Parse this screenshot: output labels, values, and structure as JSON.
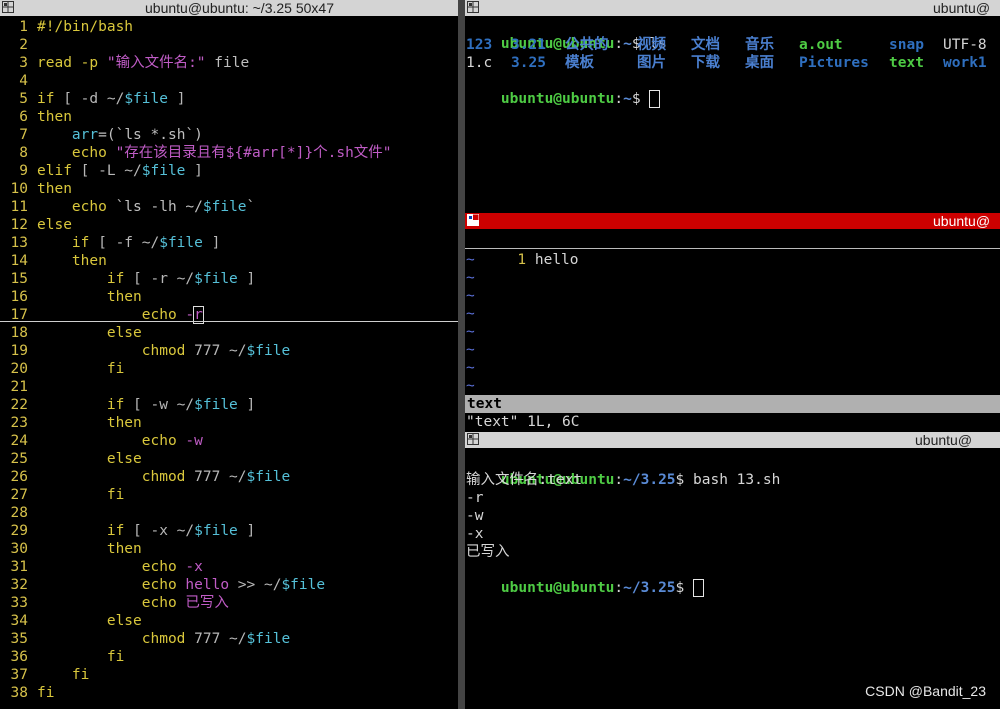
{
  "left_pane": {
    "title": "ubuntu@ubuntu: ~/3.25 50x47",
    "lines": [
      {
        "n": "1",
        "segments": [
          {
            "t": "#!/bin/bash",
            "c": "kw"
          }
        ]
      },
      {
        "n": "2",
        "segments": []
      },
      {
        "n": "3",
        "segments": [
          {
            "t": "read -p ",
            "c": "kw"
          },
          {
            "t": "\"输入文件名:\"",
            "c": "str"
          },
          {
            "t": " file",
            "c": "txt"
          }
        ]
      },
      {
        "n": "4",
        "segments": []
      },
      {
        "n": "5",
        "segments": [
          {
            "t": "if ",
            "c": "kw"
          },
          {
            "t": "[ -d ~/",
            "c": "op"
          },
          {
            "t": "$file",
            "c": "var"
          },
          {
            "t": " ]",
            "c": "op"
          }
        ]
      },
      {
        "n": "6",
        "segments": [
          {
            "t": "then",
            "c": "kw"
          }
        ]
      },
      {
        "n": "7",
        "segments": [
          {
            "t": "    ",
            "c": "txt"
          },
          {
            "t": "arr",
            "c": "var"
          },
          {
            "t": "=(`ls *.sh`)",
            "c": "txt"
          }
        ]
      },
      {
        "n": "8",
        "segments": [
          {
            "t": "    echo ",
            "c": "kw"
          },
          {
            "t": "\"存在该目录且有${#arr[*]}个.sh文件\"",
            "c": "str"
          }
        ]
      },
      {
        "n": "9",
        "segments": [
          {
            "t": "elif ",
            "c": "kw"
          },
          {
            "t": "[ -L ~/",
            "c": "op"
          },
          {
            "t": "$file",
            "c": "var"
          },
          {
            "t": " ]",
            "c": "op"
          }
        ]
      },
      {
        "n": "10",
        "segments": [
          {
            "t": "then",
            "c": "kw"
          }
        ]
      },
      {
        "n": "11",
        "segments": [
          {
            "t": "    echo ",
            "c": "kw"
          },
          {
            "t": "`ls -lh ~/",
            "c": "txt"
          },
          {
            "t": "$file",
            "c": "var"
          },
          {
            "t": "`",
            "c": "txt"
          }
        ]
      },
      {
        "n": "12",
        "segments": [
          {
            "t": "else",
            "c": "kw"
          }
        ]
      },
      {
        "n": "13",
        "segments": [
          {
            "t": "    if ",
            "c": "kw"
          },
          {
            "t": "[ -f ~/",
            "c": "op"
          },
          {
            "t": "$file",
            "c": "var"
          },
          {
            "t": " ]",
            "c": "op"
          }
        ]
      },
      {
        "n": "14",
        "segments": [
          {
            "t": "    then",
            "c": "kw"
          }
        ]
      },
      {
        "n": "15",
        "segments": [
          {
            "t": "        if ",
            "c": "kw"
          },
          {
            "t": "[ -r ~/",
            "c": "op"
          },
          {
            "t": "$file",
            "c": "var"
          },
          {
            "t": " ]",
            "c": "op"
          }
        ]
      },
      {
        "n": "16",
        "segments": [
          {
            "t": "        then",
            "c": "kw"
          }
        ]
      },
      {
        "n": "17",
        "segments": [
          {
            "t": "            echo ",
            "c": "kw"
          },
          {
            "t": "-",
            "c": "str"
          },
          {
            "t": "r",
            "c": "str",
            "cursor": true
          }
        ]
      },
      {
        "n": "18",
        "segments": [
          {
            "t": "        else",
            "c": "kw"
          }
        ]
      },
      {
        "n": "19",
        "segments": [
          {
            "t": "            chmod ",
            "c": "kw"
          },
          {
            "t": "777 ~/",
            "c": "op"
          },
          {
            "t": "$file",
            "c": "var"
          }
        ]
      },
      {
        "n": "20",
        "segments": [
          {
            "t": "        fi",
            "c": "kw"
          }
        ]
      },
      {
        "n": "21",
        "segments": []
      },
      {
        "n": "22",
        "segments": [
          {
            "t": "        if ",
            "c": "kw"
          },
          {
            "t": "[ -w ~/",
            "c": "op"
          },
          {
            "t": "$file",
            "c": "var"
          },
          {
            "t": " ]",
            "c": "op"
          }
        ]
      },
      {
        "n": "23",
        "segments": [
          {
            "t": "        then",
            "c": "kw"
          }
        ]
      },
      {
        "n": "24",
        "segments": [
          {
            "t": "            echo ",
            "c": "kw"
          },
          {
            "t": "-w",
            "c": "str"
          }
        ]
      },
      {
        "n": "25",
        "segments": [
          {
            "t": "        else",
            "c": "kw"
          }
        ]
      },
      {
        "n": "26",
        "segments": [
          {
            "t": "            chmod ",
            "c": "kw"
          },
          {
            "t": "777 ~/",
            "c": "op"
          },
          {
            "t": "$file",
            "c": "var"
          }
        ]
      },
      {
        "n": "27",
        "segments": [
          {
            "t": "        fi",
            "c": "kw"
          }
        ]
      },
      {
        "n": "28",
        "segments": []
      },
      {
        "n": "29",
        "segments": [
          {
            "t": "        if ",
            "c": "kw"
          },
          {
            "t": "[ -x ~/",
            "c": "op"
          },
          {
            "t": "$file",
            "c": "var"
          },
          {
            "t": " ]",
            "c": "op"
          }
        ]
      },
      {
        "n": "30",
        "segments": [
          {
            "t": "        then",
            "c": "kw"
          }
        ]
      },
      {
        "n": "31",
        "segments": [
          {
            "t": "            echo ",
            "c": "kw"
          },
          {
            "t": "-x",
            "c": "str"
          }
        ]
      },
      {
        "n": "32",
        "segments": [
          {
            "t": "            echo ",
            "c": "kw"
          },
          {
            "t": "hello",
            "c": "str"
          },
          {
            "t": " >> ~/",
            "c": "op"
          },
          {
            "t": "$file",
            "c": "var"
          }
        ]
      },
      {
        "n": "33",
        "segments": [
          {
            "t": "            echo ",
            "c": "kw"
          },
          {
            "t": "已写入",
            "c": "str"
          }
        ]
      },
      {
        "n": "34",
        "segments": [
          {
            "t": "        else",
            "c": "kw"
          }
        ]
      },
      {
        "n": "35",
        "segments": [
          {
            "t": "            chmod ",
            "c": "kw"
          },
          {
            "t": "777 ~/",
            "c": "op"
          },
          {
            "t": "$file",
            "c": "var"
          }
        ]
      },
      {
        "n": "36",
        "segments": [
          {
            "t": "        fi",
            "c": "kw"
          }
        ]
      },
      {
        "n": "37",
        "segments": [
          {
            "t": "    fi",
            "c": "kw"
          }
        ]
      },
      {
        "n": "38",
        "segments": [
          {
            "t": "fi",
            "c": "kw"
          }
        ]
      }
    ]
  },
  "top_right": {
    "title": "ubuntu@",
    "prompt_user": "ubuntu@ubuntu",
    "prompt_sep": ":",
    "prompt_path": "~",
    "prompt_end": "$ ",
    "command": "ls",
    "ls_row1": [
      {
        "t": "123",
        "c": "lsplain"
      },
      {
        "t": "3.21",
        "c": "lsplain"
      },
      {
        "t": "公共的",
        "c": "lsdir"
      },
      {
        "t": "视频",
        "c": "lsdir"
      },
      {
        "t": "文档",
        "c": "lsdir"
      },
      {
        "t": "音乐",
        "c": "lsdir"
      },
      {
        "t": "a.out",
        "c": "lsexec"
      },
      {
        "t": "snap",
        "c": "lsplain"
      },
      {
        "t": "UTF-8",
        "c": "plain"
      }
    ],
    "ls_row2": [
      {
        "t": "1.c",
        "c": "plain"
      },
      {
        "t": "3.25",
        "c": "lsplain"
      },
      {
        "t": "模板",
        "c": "lsdir"
      },
      {
        "t": "图片",
        "c": "lsdir"
      },
      {
        "t": "下载",
        "c": "lsdir"
      },
      {
        "t": "桌面",
        "c": "lsdir"
      },
      {
        "t": "Pictures",
        "c": "lsplain"
      },
      {
        "t": "text",
        "c": "lsexec"
      },
      {
        "t": "work1",
        "c": "lsplain"
      }
    ]
  },
  "mid_right": {
    "title": "ubuntu@",
    "line_number": "1",
    "content": "hello",
    "tilde": "~",
    "status_file": "text",
    "file_info": "\"text\" 1L, 6C"
  },
  "bottom_right": {
    "title": "ubuntu@",
    "prompt_user": "ubuntu@ubuntu",
    "prompt_sep": ":",
    "prompt_path": "~/3.25",
    "prompt_end": "$ ",
    "command": "bash 13.sh",
    "output": [
      "输入文件名:text",
      "-r",
      "-w",
      "-x",
      "已写入"
    ]
  },
  "watermark": "CSDN @Bandit_23"
}
